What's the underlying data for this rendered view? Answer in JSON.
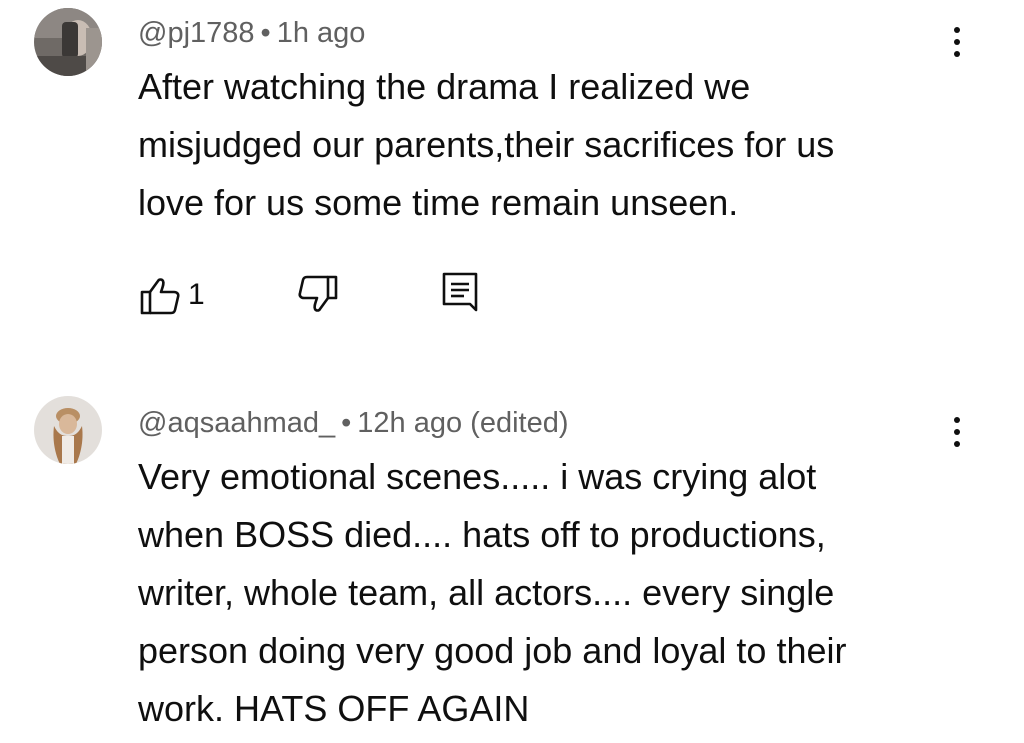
{
  "comments": [
    {
      "handle": "@pj1788",
      "time": "1h ago",
      "separator": "•",
      "lines": [
        "After watching the drama I realized we",
        "misjudged our parents,their sacrifices for us",
        "love for us some time remain unseen."
      ],
      "likes": "1",
      "icons": [
        "thumb-up-icon",
        "thumb-down-icon",
        "reply-icon",
        "more-vert-icon"
      ]
    },
    {
      "handle": "@aqsaahmad_",
      "time": "12h ago (edited)",
      "separator": "•",
      "lines": [
        "Very emotional scenes..... i was crying alot",
        "when BOSS died.... hats off to productions,",
        "writer, whole team, all actors.... every single",
        "person doing very good job and loyal to their",
        "work. HATS OFF AGAIN"
      ],
      "icons": [
        "more-vert-icon"
      ]
    }
  ]
}
